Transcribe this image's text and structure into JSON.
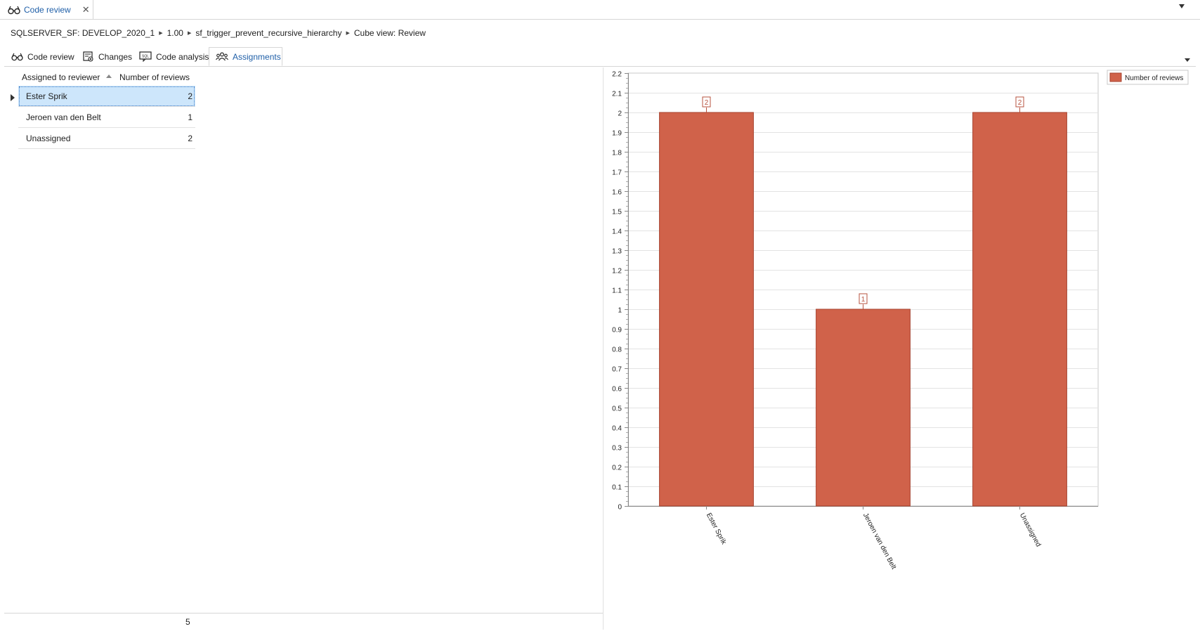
{
  "document_tab": {
    "title": "Code review",
    "icon": "glasses-icon"
  },
  "breadcrumb": [
    "SQLSERVER_SF: DEVELOP_2020_1",
    "1.00",
    "sf_trigger_prevent_recursive_hierarchy",
    "Cube view: Review"
  ],
  "view_tabs": [
    {
      "label": "Code review",
      "icon": "glasses-icon"
    },
    {
      "label": "Changes",
      "icon": "changes-icon"
    },
    {
      "label": "Code analysis",
      "icon": "sql-analysis-icon"
    },
    {
      "label": "Assignments",
      "icon": "users-icon",
      "active": true
    }
  ],
  "grid": {
    "columns": [
      "Assigned to reviewer",
      "Number of reviews"
    ],
    "rows": [
      {
        "reviewer": "Ester Sprik",
        "count": "2"
      },
      {
        "reviewer": "Jeroen van den Belt",
        "count": "1"
      },
      {
        "reviewer": "Unassigned",
        "count": "2"
      }
    ],
    "total": "5"
  },
  "chart_data": {
    "type": "bar",
    "categories": [
      "Ester Sprik",
      "Jeroen van den Belt",
      "Unassigned"
    ],
    "series": [
      {
        "name": "Number of reviews",
        "values": [
          2,
          1,
          2
        ],
        "color": "#d0624a"
      }
    ],
    "ylim": [
      0,
      2.2
    ],
    "yticks": [
      0,
      0.1,
      0.2,
      0.3,
      0.4,
      0.5,
      0.6,
      0.7,
      0.8,
      0.9,
      1,
      1.1,
      1.2,
      1.3,
      1.4,
      1.5,
      1.6,
      1.7,
      1.8,
      1.9,
      2,
      2.1,
      2.2
    ],
    "title": "",
    "xlabel": "",
    "ylabel": "",
    "data_labels": [
      "2",
      "1",
      "2"
    ],
    "grid": true,
    "legend": "top-right"
  }
}
